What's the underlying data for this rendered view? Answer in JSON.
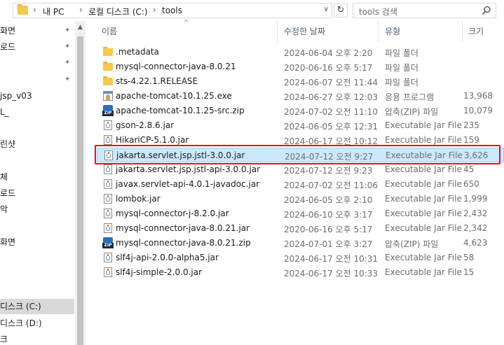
{
  "address": {
    "crumbs": [
      "내 PC",
      "로컬 디스크 (C:)",
      "tools"
    ],
    "separator": "›",
    "sep_root": "›",
    "dropdown": "∨",
    "refresh": "↻"
  },
  "search": {
    "placeholder": "tools 검색"
  },
  "nav": {
    "items": [
      {
        "label": "화면",
        "pinned": true
      },
      {
        "label": "로드",
        "pinned": true
      },
      {
        "label": "",
        "pinned": true
      },
      {
        "label": "",
        "pinned": true
      },
      {
        "label": "jsp_v03",
        "pinned": false
      },
      {
        "label": "L_",
        "pinned": false
      },
      {
        "label": "",
        "pinned": false
      },
      {
        "label": "린샷",
        "pinned": false
      },
      {
        "label": "",
        "pinned": false
      },
      {
        "label": "체",
        "pinned": false
      },
      {
        "label": "로드",
        "pinned": false
      },
      {
        "label": "악",
        "pinned": false
      },
      {
        "label": "",
        "pinned": false
      },
      {
        "label": "화면",
        "pinned": false
      },
      {
        "label": "",
        "pinned": false
      },
      {
        "label": "",
        "pinned": false
      },
      {
        "label": "",
        "pinned": false
      },
      {
        "label": "디스크 (C:)",
        "pinned": false,
        "selected": true
      },
      {
        "label": "디스크 (D:)",
        "pinned": false
      },
      {
        "label": "크",
        "pinned": false
      }
    ],
    "pin_glyph": "📌"
  },
  "columns": {
    "name": "이름",
    "date": "수정한 날짜",
    "type": "유형",
    "size": "크기"
  },
  "files": [
    {
      "name": ".metadata",
      "date": "2024-06-04 오후 2:20",
      "type": "파일 폴더",
      "size": "",
      "icon": "folder"
    },
    {
      "name": "mysql-connector-java-8.0.21",
      "date": "2020-06-16 오후 5:17",
      "type": "파일 폴더",
      "size": "",
      "icon": "folder"
    },
    {
      "name": "sts-4.22.1.RELEASE",
      "date": "2024-06-07 오전 11:44",
      "type": "파일 폴더",
      "size": "",
      "icon": "folder"
    },
    {
      "name": "apache-tomcat-10.1.25.exe",
      "date": "2024-06-27 오후 12:03",
      "type": "응용 프로그램",
      "size": "13,968",
      "icon": "exe"
    },
    {
      "name": "apache-tomcat-10.1.25-src.zip",
      "date": "2024-07-02 오전 11:10",
      "type": "압축(ZIP) 파일",
      "size": "10,079",
      "icon": "zip"
    },
    {
      "name": "gson-2.8.6.jar",
      "date": "2024-06-05 오후 12:31",
      "type": "Executable Jar File",
      "size": "235",
      "icon": "jar"
    },
    {
      "name": "HikariCP-5.1.0.jar",
      "date": "2024-06-17 오전 10:12",
      "type": "Executable Jar File",
      "size": "159",
      "icon": "jar"
    },
    {
      "name": "jakarta.servlet.jsp.jstl-3.0.0.jar",
      "date": "2024-07-12 오전 9:27",
      "type": "Executable Jar File",
      "size": "3,626",
      "icon": "jar",
      "selected": true
    },
    {
      "name": "jakarta.servlet.jsp.jstl-api-3.0.0.jar",
      "date": "2024-07-12 오전 9:23",
      "type": "Executable Jar File",
      "size": "45",
      "icon": "jar"
    },
    {
      "name": "javax.servlet-api-4.0.1-javadoc.jar",
      "date": "2024-07-02 오전 11:06",
      "type": "Executable Jar File",
      "size": "650",
      "icon": "jar"
    },
    {
      "name": "lombok.jar",
      "date": "2024-06-05 오후 2:10",
      "type": "Executable Jar File",
      "size": "1,999",
      "icon": "jar"
    },
    {
      "name": "mysql-connector-j-8.2.0.jar",
      "date": "2024-06-10 오후 3:17",
      "type": "Executable Jar File",
      "size": "2,432",
      "icon": "jar"
    },
    {
      "name": "mysql-connector-java-8.0.21.jar",
      "date": "2020-06-16 오후 5:17",
      "type": "Executable Jar File",
      "size": "2,342",
      "icon": "jar"
    },
    {
      "name": "mysql-connector-java-8.0.21.zip",
      "date": "2024-07-01 오후 3:27",
      "type": "압축(ZIP) 파일",
      "size": "4,623",
      "icon": "zip"
    },
    {
      "name": "slf4j-api-2.0.0-alpha5.jar",
      "date": "2024-06-17 오전 10:31",
      "type": "Executable Jar File",
      "size": "58",
      "icon": "jar"
    },
    {
      "name": "slf4j-simple-2.0.0.jar",
      "date": "2024-06-17 오전 10:33",
      "type": "Executable Jar File",
      "size": "15",
      "icon": "jar"
    }
  ],
  "zip_label": "ZIP",
  "scroll": {
    "up": "▲"
  },
  "sort_arrow": "^",
  "colors": {
    "selection": "#cce8ff",
    "selection_border": "#99d1ff",
    "highlight": "#e0121d",
    "header_text": "#4c607a"
  }
}
